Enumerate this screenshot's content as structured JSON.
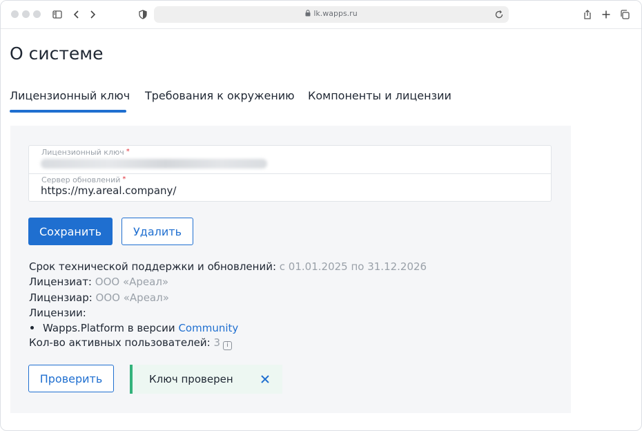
{
  "browser": {
    "url": "lk.wapps.ru",
    "icons": [
      "sidebar-icon",
      "back-icon",
      "forward-icon",
      "shield-icon",
      "lock-icon",
      "reload-icon",
      "share-icon",
      "new-tab-icon",
      "tabs-icon"
    ]
  },
  "page": {
    "title": "О системе"
  },
  "tabs": [
    {
      "label": "Лицензионный ключ",
      "active": true
    },
    {
      "label": "Требования к окружению",
      "active": false
    },
    {
      "label": "Компоненты и лицензии",
      "active": false
    }
  ],
  "form": {
    "license_key": {
      "label": "Лицензионный ключ",
      "required_mark": "*",
      "value": ""
    },
    "update_server": {
      "label": "Сервер обновлений",
      "required_mark": "*",
      "value": "https://my.areal.company/"
    }
  },
  "actions": {
    "save_label": "Сохранить",
    "delete_label": "Удалить",
    "check_label": "Проверить"
  },
  "info": {
    "support_label": "Срок технической поддержки и обновлений:",
    "support_value": "с 01.01.2025 по 31.12.2026",
    "licensee_label": "Лицензиат:",
    "licensee_value": "ООО «Ареал»",
    "licensor_label": "Лицензиар:",
    "licensor_value": "ООО «Ареал»",
    "licenses_label": "Лицензии:",
    "license_item_text": "Wapps.Platform в версии",
    "license_item_link": "Community",
    "users_label": "Кол-во активных пользователей:",
    "users_value": "3",
    "info_glyph": "i"
  },
  "toast": {
    "text": "Ключ проверен"
  },
  "colors": {
    "accent": "#1f6fd0",
    "success": "#33b27b",
    "muted": "#9aa1a9"
  }
}
